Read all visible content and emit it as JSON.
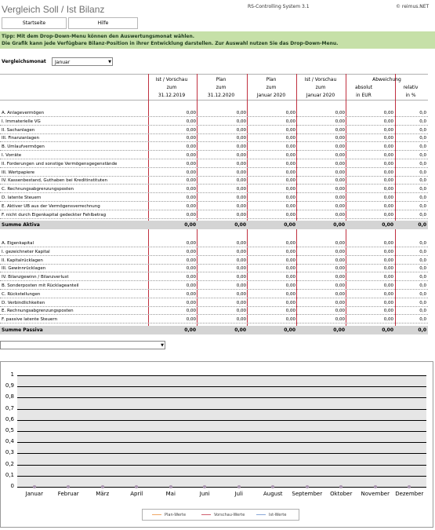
{
  "header": {
    "title": "Vergleich Soll / Ist Bilanz",
    "system": "RS-Controlling System 3.1",
    "brand": "© reimus.NET"
  },
  "nav": {
    "start_label": "Startseite",
    "help_label": "Hilfe"
  },
  "tip": {
    "line1": "Tipp: Mit dem Drop-Down-Menu können den Auswertungsmonat wählen.",
    "line2": "Die Grafik kann jede Verfügbare Bilanz-Position in ihrer Entwicklung darstellen. Zur Auswahl nutzen Sie das Drop-Down-Menu."
  },
  "compare": {
    "label": "Vergleichsmonat",
    "selected": "Januar"
  },
  "table": {
    "abweichung_label": "Abweichung",
    "columns": [
      {
        "l1": "Ist / Vorschau",
        "l2": "zum",
        "l3": "31.12.2019"
      },
      {
        "l1": "Plan",
        "l2": "zum",
        "l3": "31.12.2020"
      },
      {
        "l1": "Plan",
        "l2": "zum",
        "l3": "Januar 2020"
      },
      {
        "l1": "Ist / Vorschau",
        "l2": "zum",
        "l3": "Januar 2020"
      },
      {
        "l1": "",
        "l2": "absolut",
        "l3": "in EUR"
      },
      {
        "l1": "",
        "l2": "relativ",
        "l3": "in %"
      }
    ],
    "aktiva_rows": [
      {
        "label": "A. Anlagevermögen",
        "values": [
          "0,00",
          "0,00",
          "0,00",
          "0,00",
          "0,00",
          "0,0"
        ]
      },
      {
        "label": "I. Immaterielle VG",
        "values": [
          "0,00",
          "0,00",
          "0,00",
          "0,00",
          "0,00",
          "0,0"
        ]
      },
      {
        "label": "II. Sachanlagen",
        "values": [
          "0,00",
          "0,00",
          "0,00",
          "0,00",
          "0,00",
          "0,0"
        ]
      },
      {
        "label": "III. Finanzanlagen",
        "values": [
          "0,00",
          "0,00",
          "0,00",
          "0,00",
          "0,00",
          "0,0"
        ]
      },
      {
        "label": "B. Umlaufvermögen",
        "values": [
          "0,00",
          "0,00",
          "0,00",
          "0,00",
          "0,00",
          "0,0"
        ]
      },
      {
        "label": "I. Vorräte",
        "values": [
          "0,00",
          "0,00",
          "0,00",
          "0,00",
          "0,00",
          "0,0"
        ]
      },
      {
        "label": "II. Forderungen und sonstige Vermögensgegenstände",
        "values": [
          "0,00",
          "0,00",
          "0,00",
          "0,00",
          "0,00",
          "0,0"
        ]
      },
      {
        "label": "III. Wertpapiere",
        "values": [
          "0,00",
          "0,00",
          "0,00",
          "0,00",
          "0,00",
          "0,0"
        ]
      },
      {
        "label": "IV. Kassenbestand, Guthaben bei Kreditinstituten",
        "values": [
          "0,00",
          "0,00",
          "0,00",
          "0,00",
          "0,00",
          "0,0"
        ]
      },
      {
        "label": "C. Rechnungsabgrenzungsposten",
        "values": [
          "0,00",
          "0,00",
          "0,00",
          "0,00",
          "0,00",
          "0,0"
        ]
      },
      {
        "label": "D. latente Steuern",
        "values": [
          "0,00",
          "0,00",
          "0,00",
          "0,00",
          "0,00",
          "0,0"
        ]
      },
      {
        "label": "E. Aktiver UB aus der Vermögensverrechnung",
        "values": [
          "0,00",
          "0,00",
          "0,00",
          "0,00",
          "0,00",
          "0,0"
        ]
      },
      {
        "label": "F. nicht durch Eigenkapital gedeckter Fehlbetrag",
        "values": [
          "0,00",
          "0,00",
          "0,00",
          "0,00",
          "0,00",
          "0,0"
        ]
      }
    ],
    "aktiva_sum": {
      "label": "Summe Aktiva",
      "values": [
        "0,00",
        "0,00",
        "0,00",
        "0,00",
        "0,00",
        "0,0"
      ]
    },
    "passiva_rows": [
      {
        "label": "A. Eigenkapital",
        "values": [
          "0,00",
          "0,00",
          "0,00",
          "0,00",
          "0,00",
          "0,0"
        ]
      },
      {
        "label": "I. gezeichneter Kapital",
        "values": [
          "0,00",
          "0,00",
          "0,00",
          "0,00",
          "0,00",
          "0,0"
        ]
      },
      {
        "label": "II. Kapitalrücklagen",
        "values": [
          "0,00",
          "0,00",
          "0,00",
          "0,00",
          "0,00",
          "0,0"
        ]
      },
      {
        "label": "III. Gewinnrücklagen",
        "values": [
          "0,00",
          "0,00",
          "0,00",
          "0,00",
          "0,00",
          "0,0"
        ]
      },
      {
        "label": "IV. Bilanzgewinn / Bilanzverlust",
        "values": [
          "0,00",
          "0,00",
          "0,00",
          "0,00",
          "0,00",
          "0,0"
        ]
      },
      {
        "label": "B. Sonderposten mit Rücklageanteil",
        "values": [
          "0,00",
          "0,00",
          "0,00",
          "0,00",
          "0,00",
          "0,0"
        ]
      },
      {
        "label": "C. Rückstellungen",
        "values": [
          "0,00",
          "0,00",
          "0,00",
          "0,00",
          "0,00",
          "0,0"
        ]
      },
      {
        "label": "D. Verbindlichkeiten",
        "values": [
          "0,00",
          "0,00",
          "0,00",
          "0,00",
          "0,00",
          "0,0"
        ]
      },
      {
        "label": "E. Rechnungsabgrenzungsposten",
        "values": [
          "0,00",
          "0,00",
          "0,00",
          "0,00",
          "0,00",
          "0,0"
        ]
      },
      {
        "label": "F. passive latente Steuern",
        "values": [
          "0,00",
          "0,00",
          "0,00",
          "0,00",
          "0,00",
          "0,0"
        ]
      }
    ],
    "passiva_sum": {
      "label": "Summe Passiva",
      "values": [
        "0,00",
        "0,00",
        "0,00",
        "0,00",
        "0,00",
        "0,0"
      ]
    }
  },
  "chart_select": {
    "selected": ""
  },
  "chart_data": {
    "type": "line",
    "categories": [
      "Januar",
      "Februar",
      "März",
      "April",
      "Mai",
      "Juni",
      "Juli",
      "August",
      "September",
      "Oktober",
      "November",
      "Dezember"
    ],
    "series": [
      {
        "name": "Plan-Werte",
        "color": "#f0a868",
        "values": [
          0,
          0,
          0,
          0,
          0,
          0,
          0,
          0,
          0,
          0,
          0,
          0
        ]
      },
      {
        "name": "Vorschau-Werte",
        "color": "#d06070",
        "values": [
          0,
          0,
          0,
          0,
          0,
          0,
          0,
          0,
          0,
          0,
          0,
          0
        ]
      },
      {
        "name": "Ist-Werte",
        "color": "#8aa8d8",
        "values": [
          0,
          0,
          0,
          0,
          0,
          0,
          0,
          0,
          0,
          0,
          0,
          0
        ]
      }
    ],
    "ylim": [
      0,
      1
    ],
    "yticks": [
      "0",
      "0,1",
      "0,2",
      "0,3",
      "0,4",
      "0,5",
      "0,6",
      "0,7",
      "0,8",
      "0,9",
      "1"
    ],
    "grid": true,
    "legend": "bottom"
  }
}
